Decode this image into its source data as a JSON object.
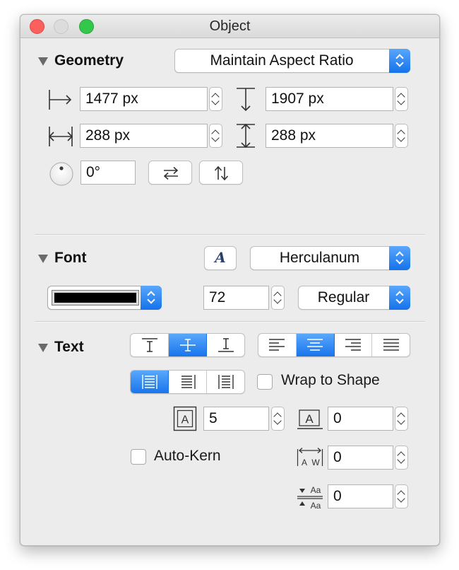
{
  "window": {
    "title": "Object"
  },
  "geometry": {
    "title": "Geometry",
    "aspect_popup": "Maintain Aspect Ratio",
    "x": "1477 px",
    "y": "1907 px",
    "width": "288 px",
    "height": "288 px",
    "rotation": "0°"
  },
  "font": {
    "title": "Font",
    "font_button_glyph": "A",
    "font_name": "Herculanum",
    "color": "#000000",
    "size": "72",
    "style": "Regular"
  },
  "text": {
    "title": "Text",
    "wrap_label": "Wrap to Shape",
    "wrap_checked": false,
    "inset": "5",
    "baseline": "0",
    "autokern_label": "Auto-Kern",
    "autokern_checked": false,
    "kerning": "0",
    "line_spacing": "0",
    "icon_glyphs": {
      "inset": "A",
      "baseline": "A",
      "kern_a": "A",
      "kern_w": "W",
      "spacing_top": "Aa",
      "spacing_bottom": "Aa"
    }
  },
  "colors": {
    "accent": "#1a74ec"
  }
}
